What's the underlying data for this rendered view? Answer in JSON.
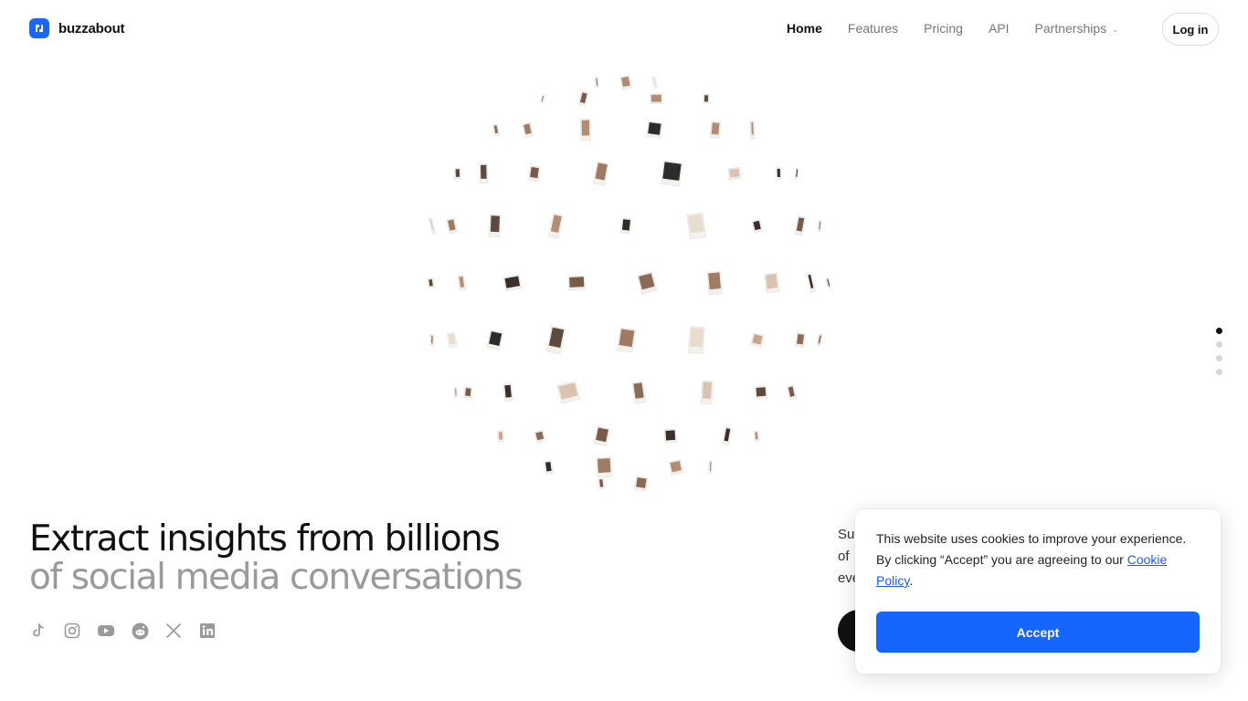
{
  "brand": {
    "name": "buzzabout",
    "accent": "#1a66ff"
  },
  "nav": {
    "items": [
      {
        "label": "Home",
        "active": true
      },
      {
        "label": "Features",
        "active": false
      },
      {
        "label": "Pricing",
        "active": false
      },
      {
        "label": "API",
        "active": false
      },
      {
        "label": "Partnerships",
        "active": false,
        "dropdown": true
      }
    ],
    "login_label": "Log in"
  },
  "hero": {
    "title_line1": "Extract insights from billions",
    "title_line2": "of social media conversations",
    "sub_text_lines": [
      "Su",
      "of",
      "eve"
    ]
  },
  "socials": [
    "tiktok-icon",
    "instagram-icon",
    "youtube-icon",
    "reddit-icon",
    "x-icon",
    "linkedin-icon"
  ],
  "scroll_dots": {
    "count": 4,
    "active_index": 0
  },
  "cookie": {
    "line1": "This website uses cookies to improve your experience.",
    "line2_prefix": "By clicking “Accept” you are agreeing to our ",
    "link_label": "Cookie Policy",
    "suffix": ".",
    "accept_label": "Accept",
    "accent": "#1466ff"
  }
}
